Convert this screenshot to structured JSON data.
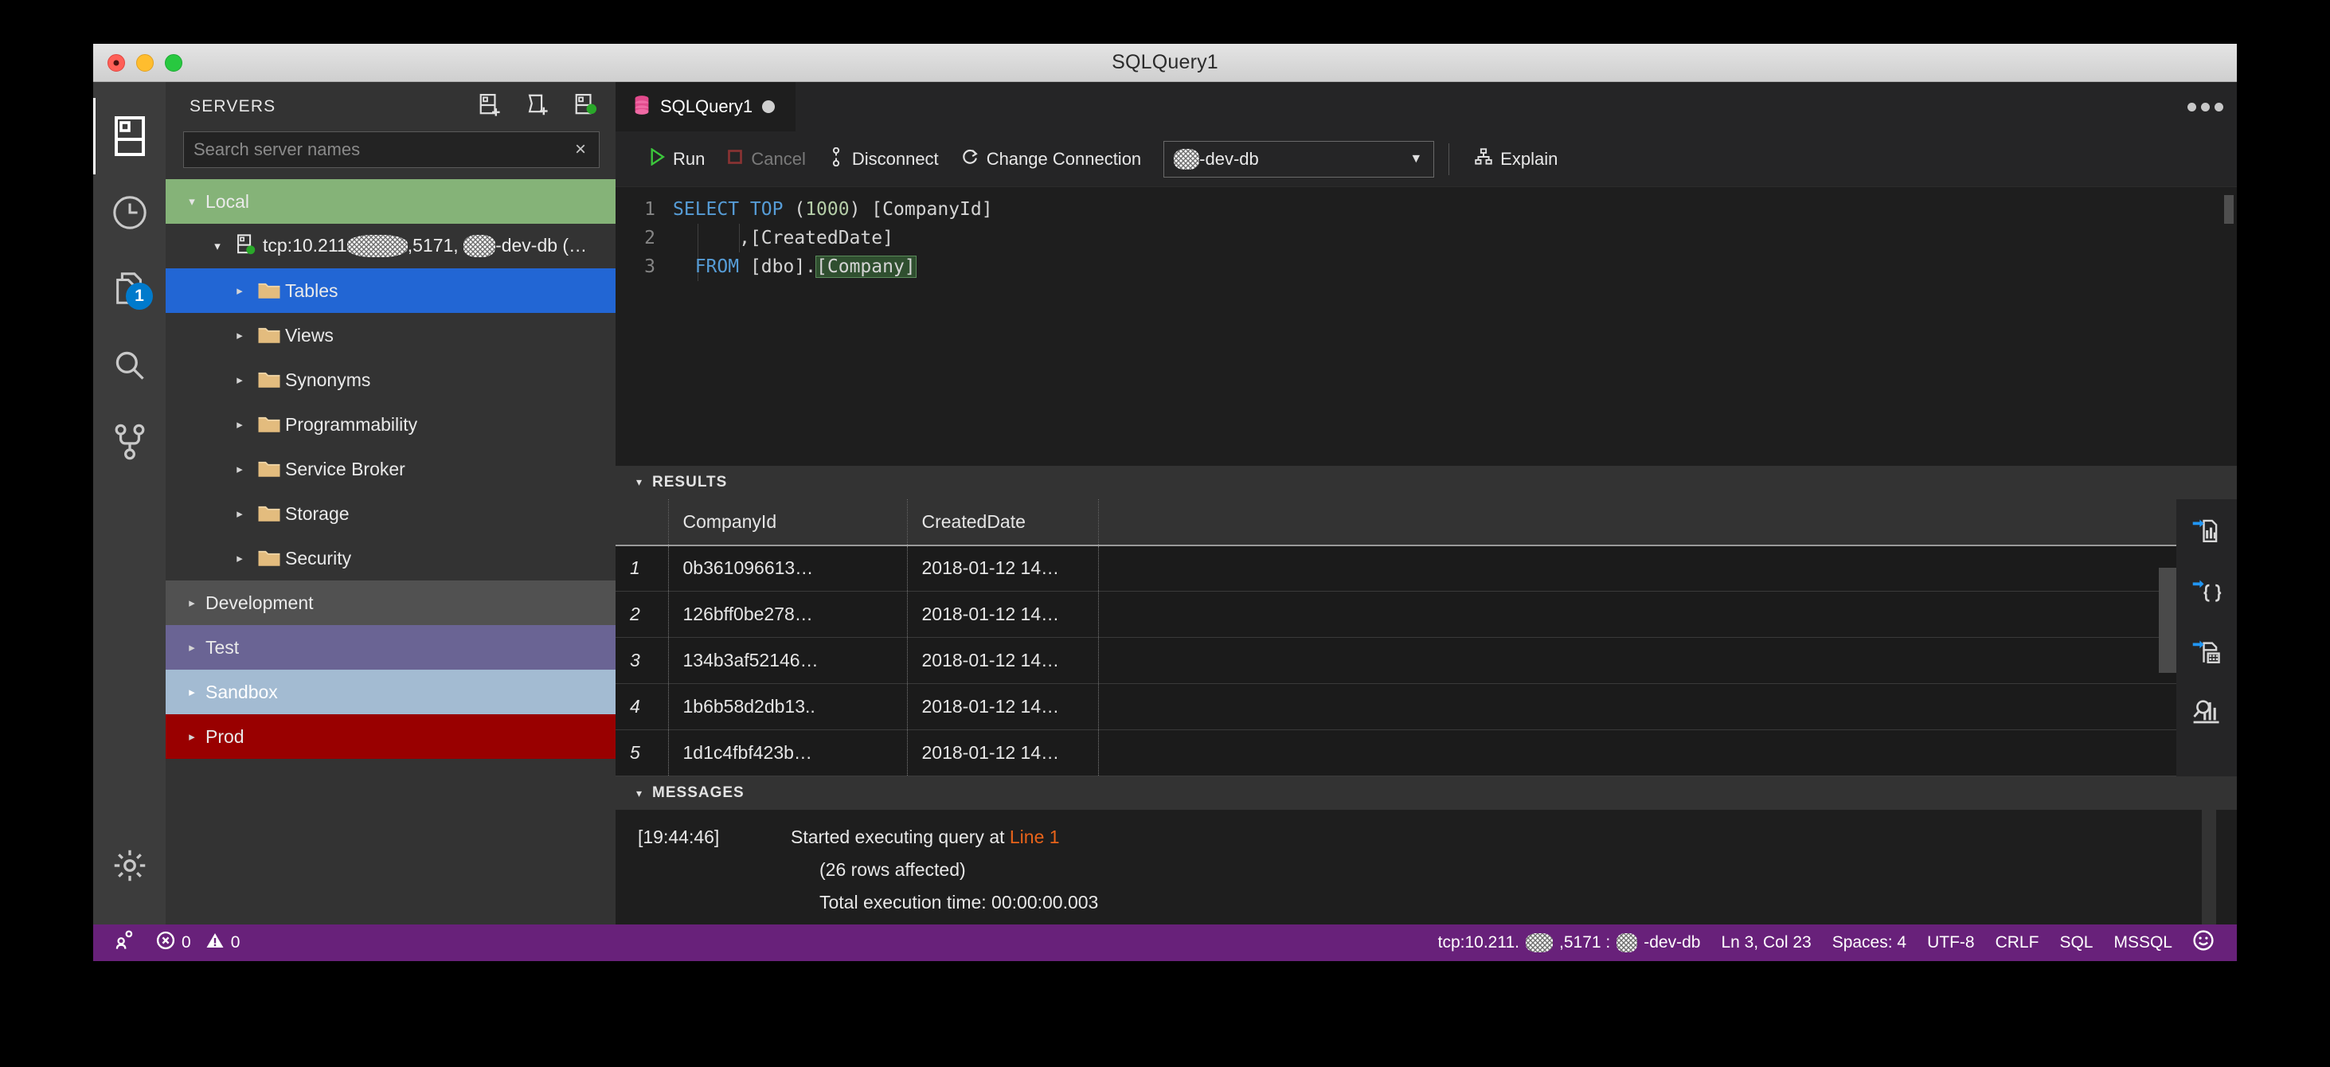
{
  "window": {
    "title": "SQLQuery1",
    "traffic_lights": [
      "close-button",
      "minimize-button",
      "zoom-button"
    ]
  },
  "activitybar": {
    "items": [
      {
        "name": "servers",
        "icon": "server-icon",
        "active": true,
        "badge": null
      },
      {
        "name": "history",
        "icon": "clock-icon",
        "active": false,
        "badge": null
      },
      {
        "name": "tasks",
        "icon": "files-icon",
        "active": false,
        "badge": "1"
      },
      {
        "name": "search",
        "icon": "search-icon",
        "active": false,
        "badge": null
      },
      {
        "name": "source-control",
        "icon": "source-control-icon",
        "active": false,
        "badge": null
      },
      {
        "name": "manage",
        "icon": "gear-icon",
        "active": false,
        "badge": null
      }
    ]
  },
  "sidebar": {
    "title": "SERVERS",
    "actions": [
      {
        "name": "add-connection",
        "icon": "new-connection-icon"
      },
      {
        "name": "add-server-group",
        "icon": "new-server-group-icon"
      },
      {
        "name": "show-active-connections",
        "icon": "active-connections-icon"
      }
    ],
    "search": {
      "placeholder": "Search server names",
      "value": "",
      "clear_label": "×"
    },
    "groups": [
      {
        "name": "local",
        "label": "Local",
        "color": "#85b378",
        "expanded": true
      },
      {
        "name": "development",
        "label": "Development",
        "color": "#515151",
        "expanded": false
      },
      {
        "name": "test",
        "label": "Test",
        "color": "#6a6494",
        "expanded": false
      },
      {
        "name": "sandbox",
        "label": "Sandbox",
        "color": "#a3bbd2",
        "expanded": false
      },
      {
        "name": "prod",
        "label": "Prod",
        "color": "#990000",
        "expanded": false
      }
    ],
    "server": {
      "label_parts": [
        "tcp:10.211",
        "█",
        ",5171, ",
        "█",
        "-dev-db (",
        "█",
        ".."
      ],
      "label_prefix": "tcp:10.211",
      "label_mid": ",5171, ",
      "label_db": "-dev-db (",
      "label_suffix": "..",
      "status": "connected"
    },
    "nodes": [
      {
        "label": "Tables",
        "selected": true
      },
      {
        "label": "Views",
        "selected": false
      },
      {
        "label": "Synonyms",
        "selected": false
      },
      {
        "label": "Programmability",
        "selected": false
      },
      {
        "label": "Service Broker",
        "selected": false
      },
      {
        "label": "Storage",
        "selected": false
      },
      {
        "label": "Security",
        "selected": false
      }
    ]
  },
  "editor": {
    "tab": {
      "label": "SQLQuery1",
      "dirty": true,
      "icon": "database-icon"
    },
    "more_actions_label": "…",
    "toolbar": {
      "run": "Run",
      "cancel": "Cancel",
      "disconnect": "Disconnect",
      "change_connection": "Change Connection",
      "connection_value": "-dev-db",
      "explain": "Explain"
    },
    "code": {
      "lines": [
        {
          "n": "1",
          "tokens": [
            {
              "t": "SELECT TOP ",
              "c": "kw"
            },
            {
              "t": "(",
              "c": "punct"
            },
            {
              "t": "1000",
              "c": "num"
            },
            {
              "t": ") [CompanyId]",
              "c": "punct"
            }
          ]
        },
        {
          "n": "2",
          "tokens": [
            {
              "t": "      ,[CreatedDate]",
              "c": "punct"
            }
          ]
        },
        {
          "n": "3",
          "tokens": [
            {
              "t": "  FROM ",
              "c": "kw"
            },
            {
              "t": "[dbo].",
              "c": "punct"
            },
            {
              "t": "[Company]",
              "c": "punct"
            }
          ]
        }
      ]
    }
  },
  "results": {
    "header": "RESULTS",
    "columns": [
      "",
      "CompanyId",
      "CreatedDate",
      ""
    ],
    "rows": [
      {
        "n": "1",
        "CompanyId": "0b361096613…",
        "CreatedDate": "2018-01-12 14…"
      },
      {
        "n": "2",
        "CompanyId": "126bff0be278…",
        "CreatedDate": "2018-01-12 14…"
      },
      {
        "n": "3",
        "CompanyId": "134b3af52146…",
        "CreatedDate": "2018-01-12 14…"
      },
      {
        "n": "4",
        "CompanyId": "1b6b58d2db13..",
        "CreatedDate": "2018-01-12 14…"
      },
      {
        "n": "5",
        "CompanyId": "1d1c4fbf423b…",
        "CreatedDate": "2018-01-12 14…"
      }
    ],
    "actions": [
      {
        "name": "save-as-csv",
        "icon": "save-csv-icon"
      },
      {
        "name": "save-as-json",
        "icon": "save-json-icon"
      },
      {
        "name": "save-as-excel",
        "icon": "save-excel-icon"
      },
      {
        "name": "view-as-chart",
        "icon": "chart-icon"
      }
    ]
  },
  "messages": {
    "header": "MESSAGES",
    "timestamp": "[19:44:46]",
    "line1_prefix": "Started executing query at ",
    "line1_link": "Line 1",
    "line2": "(26 rows affected)",
    "line3": "Total execution time: 00:00:00.003"
  },
  "statusbar": {
    "remote_icon": "remote-connection-icon",
    "errors": "0",
    "warnings": "0",
    "connection": "tcp:10.211.",
    "connection_port": ",5171 : ",
    "connection_db": "-dev-db",
    "cursor": "Ln 3, Col 23",
    "spaces": "Spaces: 4",
    "encoding": "UTF-8",
    "eol": "CRLF",
    "language": "SQL",
    "provider": "MSSQL",
    "feedback_icon": "smiley-icon",
    "background": "#68217a"
  }
}
